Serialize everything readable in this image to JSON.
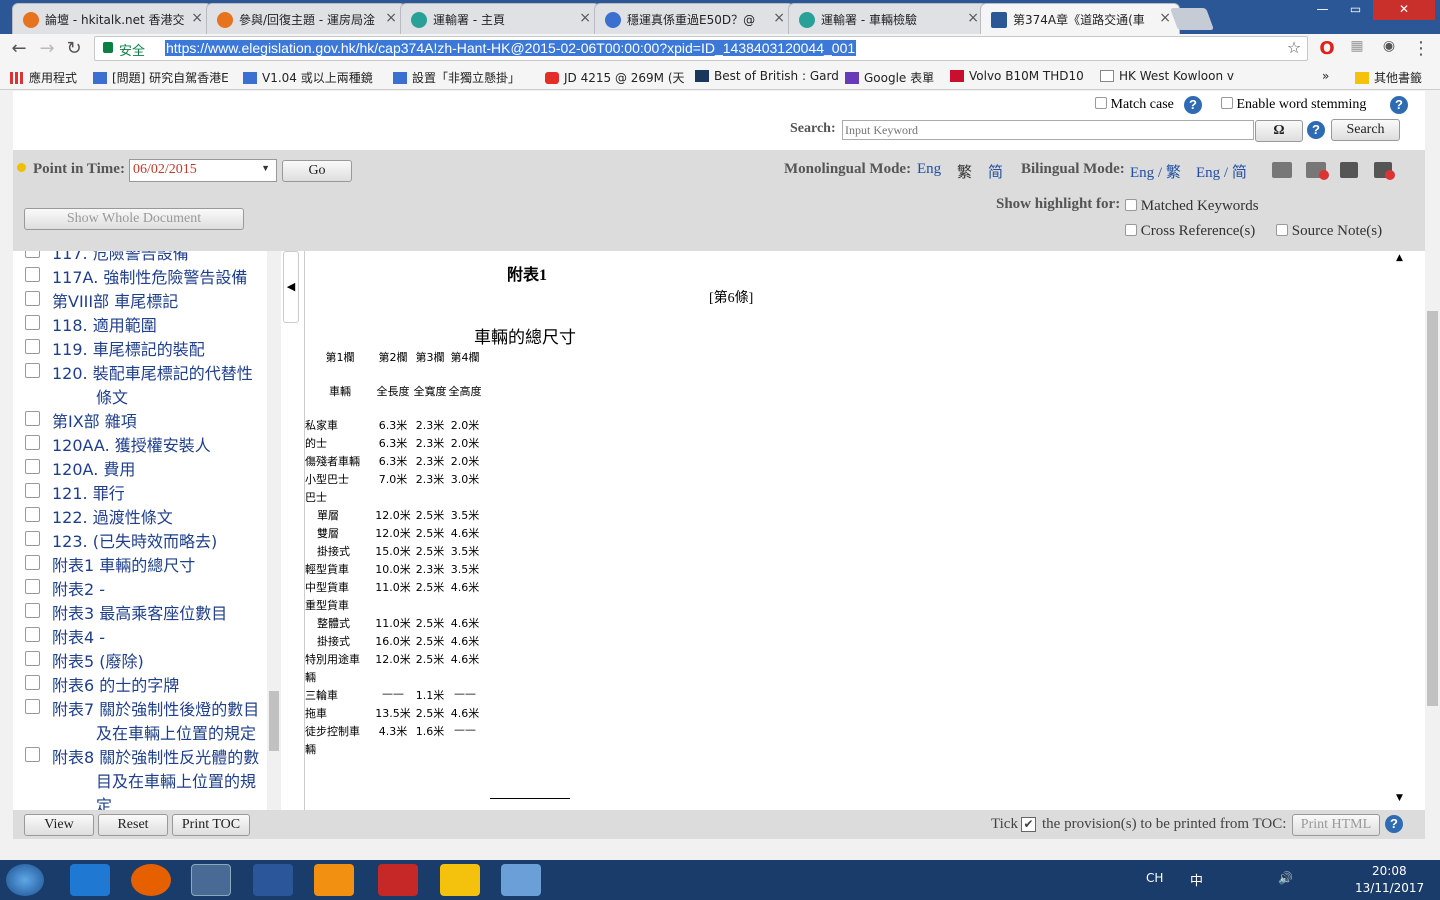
{
  "tabs": [
    {
      "title": "論壇 - hkitalk.net 香港交",
      "fav": "#e8731f"
    },
    {
      "title": "參與/回復主題 - 運房局淦",
      "fav": "#e8731f"
    },
    {
      "title": "運輸署 - 主頁",
      "fav": "#2aa198"
    },
    {
      "title": "穩運真係重過E50D？@",
      "fav": "#3b6fd0"
    },
    {
      "title": "運輸署 - 車輛檢驗",
      "fav": "#2aa198"
    },
    {
      "title": "第374A章《道路交通(車",
      "fav": "#2b5797"
    }
  ],
  "address": {
    "secure_label": "安全",
    "url": "https://www.elegislation.gov.hk/hk/cap374A!zh-Hant-HK@2015-02-06T00:00:00?xpid=ID_1438403120044_001"
  },
  "bookmarks": [
    "應用程式",
    "[問題] 研究自駕香港E",
    "V1.04 或以上兩種鏡",
    "設置「非獨立懸掛」",
    "JD 4215 @ 269M (天",
    "Best of British : Gard",
    "Google 表單",
    "Volvo B10M THD10",
    "HK West Kowloon v",
    "»",
    "其他書籤"
  ],
  "search": {
    "match_case": "Match case",
    "word_stemming": "Enable word stemming",
    "label": "Search:",
    "placeholder": "Input Keyword",
    "omega": "Ω",
    "button": "Search"
  },
  "controls": {
    "pit_label": "Point in Time:",
    "pit_value": "06/02/2015",
    "go": "Go",
    "mono_label": "Monolingual Mode:",
    "mono_eng": "Eng",
    "mono_tc": "繁",
    "mono_sc": "简",
    "bi_label": "Bilingual Mode:",
    "bi_eng_tc": "Eng / 繁",
    "bi_eng_sc": "Eng / 简",
    "show_whole": "Show Whole Document",
    "highlight_label": "Show highlight for:",
    "hl_matched": "Matched Keywords",
    "hl_cross": "Cross Reference(s)",
    "hl_source": "Source Note(s)"
  },
  "toc": [
    "117. 危險警告設備",
    "117A. 強制性危險警告設備",
    "第VIII部 車尾標記",
    "118. 適用範圍",
    "119. 車尾標記的裝配",
    "120. 裝配車尾標記的代替性",
    "條文",
    "第IX部 雜項",
    "120AA. 獲授權安裝人",
    "120A. 費用",
    "121. 罪行",
    "122. 過渡性條文",
    "123. (已失時效而略去)",
    "附表1 車輛的總尺寸",
    "附表2 -",
    "附表3 最高乘客座位數目",
    "附表4 -",
    "附表5 (廢除)",
    "附表6 的士的字牌",
    "附表7 關於強制性後燈的數目",
    "及在車輛上位置的規定",
    "附表8 關於強制性反光體的數",
    "目及在車輛上位置的規",
    "定"
  ],
  "doc": {
    "schedule": "附表1",
    "section_ref": "[第6條]",
    "title": "車輛的總尺寸",
    "col_headers": [
      "第1欄",
      "第2欄",
      "第3欄",
      "第4欄"
    ],
    "sub_headers": [
      "車輛",
      "全長度",
      "全寬度",
      "全高度"
    ],
    "rows": [
      [
        "私家車",
        "6.3米",
        "2.3米",
        "2.0米"
      ],
      [
        "的士",
        "6.3米",
        "2.3米",
        "2.0米"
      ],
      [
        "傷殘者車輛",
        "6.3米",
        "2.3米",
        "2.0米"
      ],
      [
        "小型巴士",
        "7.0米",
        "2.3米",
        "3.0米"
      ],
      [
        "巴士",
        "",
        "",
        ""
      ],
      [
        "單層",
        "12.0米",
        "2.5米",
        "3.5米"
      ],
      [
        "雙層",
        "12.0米",
        "2.5米",
        "4.6米"
      ],
      [
        "掛接式",
        "15.0米",
        "2.5米",
        "3.5米"
      ],
      [
        "輕型貨車",
        "10.0米",
        "2.3米",
        "3.5米"
      ],
      [
        "中型貨車",
        "11.0米",
        "2.5米",
        "4.6米"
      ],
      [
        "重型貨車",
        "",
        "",
        ""
      ],
      [
        "整體式",
        "11.0米",
        "2.5米",
        "4.6米"
      ],
      [
        "掛接式",
        "16.0米",
        "2.5米",
        "4.6米"
      ],
      [
        "特別用途車",
        "12.0米",
        "2.5米",
        "4.6米"
      ],
      [
        "輛",
        "",
        "",
        ""
      ],
      [
        "三輪車",
        "——",
        "1.1米",
        "——"
      ],
      [
        "拖車",
        "13.5米",
        "2.5米",
        "4.6米"
      ],
      [
        "徒步控制車",
        "4.3米",
        "1.6米",
        "——"
      ],
      [
        "輛",
        "",
        "",
        ""
      ]
    ]
  },
  "bottom": {
    "view": "View",
    "reset": "Reset",
    "print_toc": "Print TOC",
    "tick": "Tick",
    "tick_rest": "the provision(s) to be printed from TOC:",
    "print_html": "Print HTML"
  },
  "tray": {
    "lang": "CH",
    "ime": "中",
    "time": "20:08",
    "date": "13/11/2017"
  }
}
